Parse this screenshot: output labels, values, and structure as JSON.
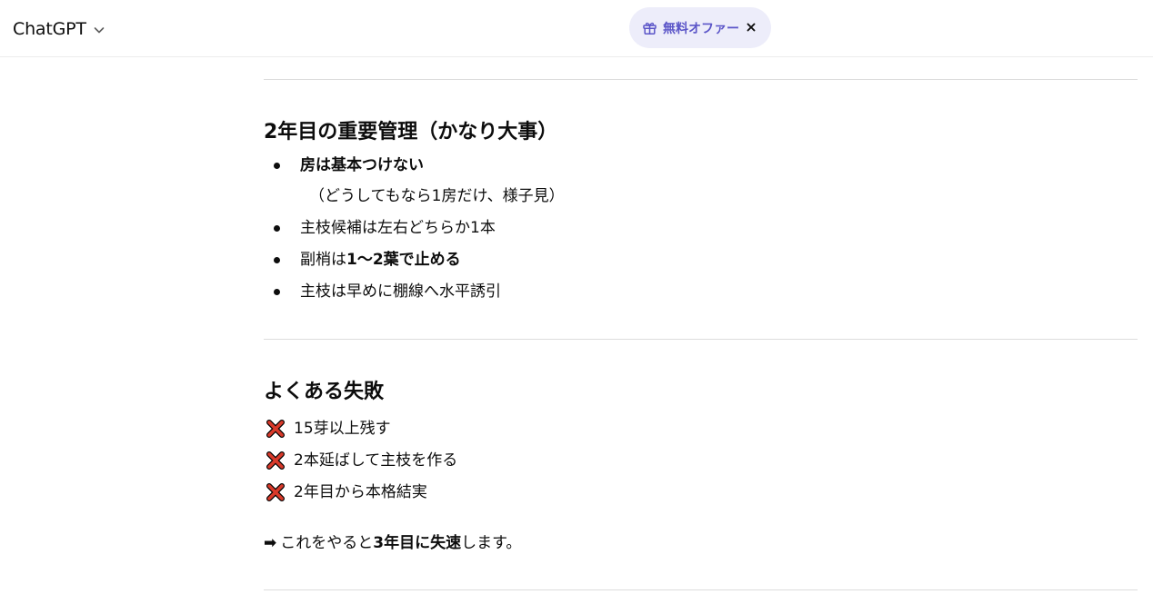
{
  "header": {
    "model_name": "ChatGPT",
    "offer_label": "無料オファー",
    "icons": {
      "model_chevron": "chevron-down-icon",
      "offer": "gift-icon",
      "close": "close-icon"
    }
  },
  "section_year2": {
    "heading": "2年目の重要管理（かなり大事）",
    "items": [
      {
        "bold": "房は基本つけない",
        "sub": "（どうしてもなら1房だけ、様子見）"
      },
      {
        "text": "主枝候補は左右どちらか1本"
      },
      {
        "pre": "副梢は",
        "bold": "1〜2葉で止める"
      },
      {
        "text": "主枝は早めに棚線へ水平誘引"
      }
    ]
  },
  "section_mistakes": {
    "heading": "よくある失敗",
    "items": [
      "15芽以上残す",
      "2本延ばして主枝を作る",
      "2年目から本格結実"
    ],
    "icon": "cross-mark-icon",
    "conclusion": {
      "arrow": "➡",
      "pre": "これをやると",
      "bold": "3年目に失速",
      "post": "します。"
    }
  },
  "colors": {
    "offer_bg": "#ededfa",
    "offer_text": "#5b55c8",
    "cross_red": "#d93a2b",
    "divider": "#dcdcdc"
  }
}
